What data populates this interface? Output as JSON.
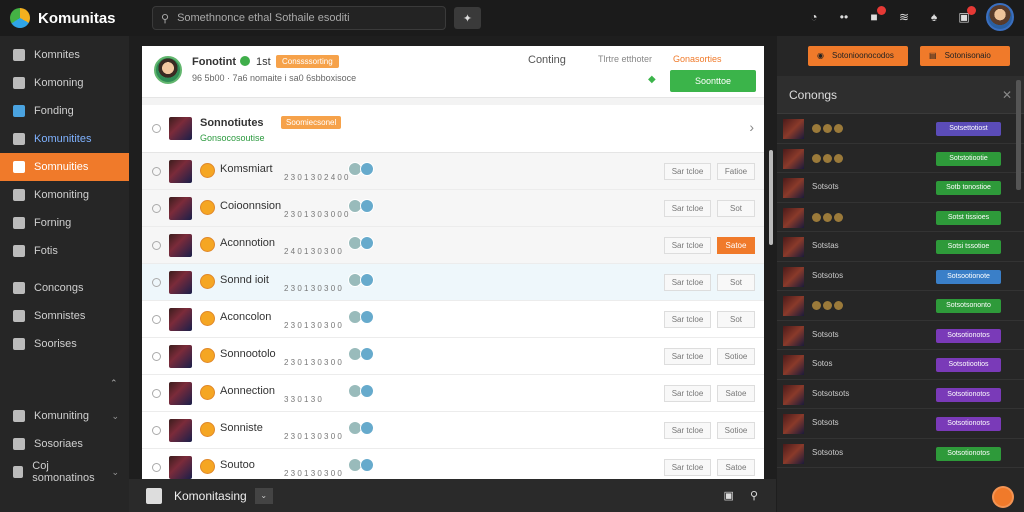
{
  "app": {
    "name": "Komunitas"
  },
  "search": {
    "placeholder": "Somethnonce ethal Sothaile esoditi"
  },
  "sidebar": {
    "items": [
      {
        "label": "Komnites",
        "icon": "cube-icon",
        "active": false
      },
      {
        "label": "Komoning",
        "icon": "picture-icon",
        "active": false
      },
      {
        "label": "Fonding",
        "icon": "screen-icon",
        "active": false
      },
      {
        "label": "Komunitites",
        "icon": "puzzle-icon",
        "active": false
      },
      {
        "label": "Somnuities",
        "icon": "community-icon",
        "active": true
      },
      {
        "label": "Komoniting",
        "icon": "shield-icon",
        "active": false
      },
      {
        "label": "Forning",
        "icon": "grid-icon",
        "active": false
      },
      {
        "label": "Fotis",
        "icon": "tree-icon",
        "active": false
      },
      {
        "label": "Concongs",
        "icon": "gear-icon",
        "active": false
      },
      {
        "label": "Somnistes",
        "icon": "book-icon",
        "active": false
      },
      {
        "label": "Soorises",
        "icon": "sparkle-icon",
        "active": false
      },
      {
        "label": "Komuniting",
        "icon": "chat-icon",
        "active": false
      },
      {
        "label": "Sosoriaes",
        "icon": "window-icon",
        "active": false
      },
      {
        "label": "Coj somonatinos",
        "icon": "globe-icon",
        "active": false
      }
    ]
  },
  "profile": {
    "name": "Fonotint",
    "number": "1st",
    "tag": "Conssssorting",
    "stats": "96 5b00 · 7a6 nomaite i sa0 6sbboxisoce",
    "count_label": "Conting",
    "grey_label": "Tlrtre etthoter",
    "orange_label": "Gonasorties",
    "join_label": "Soonttoe"
  },
  "community": {
    "title": "Sonnotiutes",
    "subtitle": "Gonsocosoutise",
    "tag": "Soomiecsonel"
  },
  "rows": [
    {
      "name": "Komsmiart",
      "meta": "2 3 0 1 3 0 2 4 0 0",
      "btn_a": "Sar tcloe",
      "btn_b": "Fatioe",
      "orange": false
    },
    {
      "name": "Coioonnsion",
      "meta": "2 3 0 1 3 0 3 0 0 0",
      "btn_a": "Sar tcloe",
      "btn_b": "Sot",
      "orange": false
    },
    {
      "name": "Aconnotion",
      "meta": "2 4 0 1 3 0 3 0 0",
      "btn_a": "Sar tcloe",
      "btn_b": "Satoe",
      "orange": true
    },
    {
      "name": "Sonnd ioit",
      "meta": "2 3 0 1 3 0 3 0 0",
      "btn_a": "Sar tcloe",
      "btn_b": "Sot",
      "orange": false
    },
    {
      "name": "Aconcolon",
      "meta": "2 3 0 1 3 0 3 0 0",
      "btn_a": "Sar tcloe",
      "btn_b": "Sot",
      "orange": false
    },
    {
      "name": "Sonnootolo",
      "meta": "2 3 0 1 3 0 3 0 0",
      "btn_a": "Sar tcloe",
      "btn_b": "Sotioe",
      "orange": false
    },
    {
      "name": "Aonnection",
      "meta": "3 3 0 1 3 0",
      "btn_a": "Sar tcloe",
      "btn_b": "Satoe",
      "orange": false
    },
    {
      "name": "Sonniste",
      "meta": "2 3 0 1 3 0 3 0 0",
      "btn_a": "Sar tcloe",
      "btn_b": "Sotioe",
      "orange": false
    },
    {
      "name": "Soutoo",
      "meta": "2 3 0 1 3 0 3 0 0",
      "btn_a": "Sar tcloe",
      "btn_b": "Satoe",
      "orange": false
    }
  ],
  "bottombar": {
    "label": "Komonitasing"
  },
  "right_panel": {
    "btn1": "Sotonioonocodos",
    "btn2": "Sotonisonaio",
    "title": "Conongs",
    "items": [
      {
        "text": "",
        "badge": "Sotsettotiost",
        "color": "#5b4cb8"
      },
      {
        "text": "",
        "badge": "Sotstotiootie",
        "color": "#2e9a3a"
      },
      {
        "text": "Sotsots",
        "badge": "Sotb tonostioe",
        "color": "#2e9a3a"
      },
      {
        "text": "",
        "badge": "Sotst tissioes",
        "color": "#2e9a3a"
      },
      {
        "text": "Sotstas",
        "badge": "Sotsi tssotioe",
        "color": "#2e9a3a"
      },
      {
        "text": "Sotsotos",
        "badge": "Sotsootionote",
        "color": "#3a7fc8"
      },
      {
        "text": "",
        "badge": "Sotsotsononto",
        "color": "#2e9a3a"
      },
      {
        "text": "Sotsots",
        "badge": "Sotsotionotos",
        "color": "#7a3ab8"
      },
      {
        "text": "Sotos",
        "badge": "Sotsotiootios",
        "color": "#7a3ab8"
      },
      {
        "text": "Sotsotsots",
        "badge": "Sotsotionotos",
        "color": "#7a3ab8"
      },
      {
        "text": "Sotsots",
        "badge": "Sotsotionotos",
        "color": "#7a3ab8"
      },
      {
        "text": "Sotsotos",
        "badge": "Sotsotionotos",
        "color": "#2e9a3a"
      }
    ]
  },
  "colors": {
    "accent": "#f07a2a",
    "green": "#3bb44a"
  }
}
